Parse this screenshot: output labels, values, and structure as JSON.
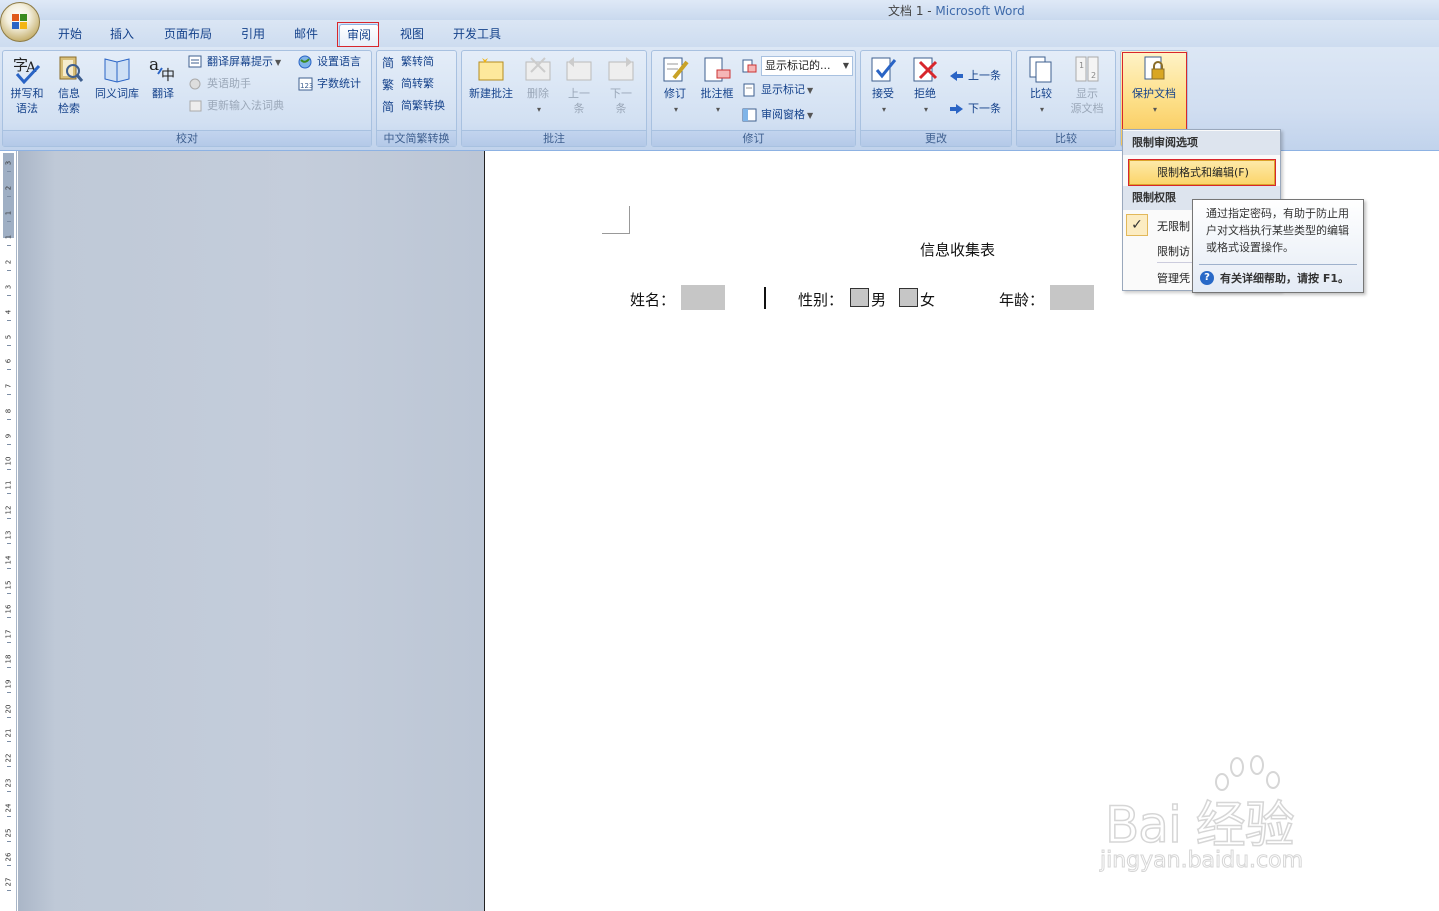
{
  "window": {
    "doc_name": "文档 1 - ",
    "app_name": "Microsoft Word"
  },
  "tabs": [
    "开始",
    "插入",
    "页面布局",
    "引用",
    "邮件",
    "审阅",
    "视图",
    "开发工具"
  ],
  "active_tab": "审阅",
  "ribbon": {
    "proofing": {
      "label": "校对",
      "spelling": "拼写和\n语法",
      "research": "信息\n检索",
      "thesaurus": "同义词库",
      "translate": "翻译",
      "translate_tip": "翻译屏幕提示",
      "english_assistant": "英语助手",
      "update_ime": "更新输入法词典",
      "set_language": "设置语言",
      "word_count": "字数统计"
    },
    "chinese": {
      "label": "中文简繁转换",
      "to_simplified": "繁转简",
      "to_traditional": "简转繁",
      "convert": "简繁转换"
    },
    "comments": {
      "label": "批注",
      "new": "新建批注",
      "delete": "删除",
      "previous": "上一\n条",
      "next": "下一\n条"
    },
    "tracking": {
      "label": "修订",
      "track_changes": "修订",
      "balloons": "批注框",
      "display_markup": "显示标记的...",
      "show_markup": "显示标记",
      "reviewing_pane": "审阅窗格"
    },
    "changes": {
      "label": "更改",
      "accept": "接受",
      "reject": "拒绝",
      "previous": "上一条",
      "next": "下一条"
    },
    "compare": {
      "label": "比较",
      "compare": "比较",
      "show_source": "显示\n源文档"
    },
    "protect": {
      "protect_document": "保护文档"
    }
  },
  "document": {
    "title": "信息收集表",
    "name_label": "姓名：",
    "gender_label": "性别：",
    "male": "男",
    "female": "女",
    "age_label": "年龄："
  },
  "dropdown": {
    "header_review": "限制审阅选项",
    "restrict_formatting": "限制格式和编辑(F)",
    "header_permission": "限制权限",
    "unrestricted": "无限制",
    "restricted": "限制访",
    "manage": "管理凭"
  },
  "tooltip": {
    "body": "通过指定密码，有助于防止用户对文档执行某些类型的编辑或格式设置操作。",
    "help": "有关详细帮助，请按 F1。"
  },
  "watermark": {
    "brand": "Bai 经验",
    "url": "jingyan.baidu.com"
  },
  "ruler_numbers": [
    "3",
    "2",
    "1",
    "1",
    "2",
    "3",
    "4",
    "5",
    "6",
    "7",
    "8",
    "9",
    "10",
    "11",
    "12",
    "13",
    "14",
    "15",
    "16",
    "17",
    "18",
    "19",
    "20",
    "21",
    "22",
    "23",
    "24",
    "25",
    "26",
    "27"
  ],
  "colors": {
    "accent": "#15428b",
    "highlight": "#fbd56b",
    "mark": "#d8262c"
  }
}
